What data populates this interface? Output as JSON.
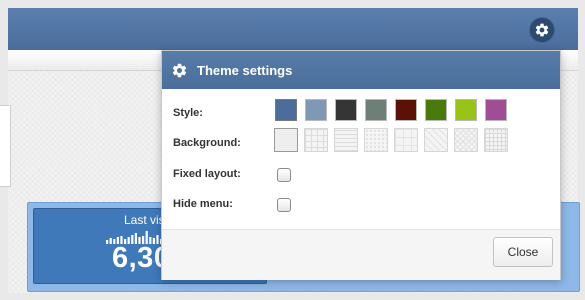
{
  "stat": {
    "title": "Last vis",
    "value": "6,30",
    "sparkline": [
      4,
      6,
      5,
      7,
      9,
      5,
      8,
      10,
      12,
      7,
      9,
      14,
      8,
      6,
      10,
      5
    ]
  },
  "theme_panel": {
    "title": "Theme settings",
    "header_icon": "gear-icon",
    "style_label": "Style:",
    "background_label": "Background:",
    "fixed_layout_label": "Fixed layout:",
    "hide_menu_label": "Hide menu:",
    "fixed_layout_checked": false,
    "hide_menu_checked": false,
    "style_colors": [
      "#4a6d9c",
      "#7f98b6",
      "#353535",
      "#6d7f76",
      "#5a1206",
      "#4a7a0c",
      "#98c318",
      "#a04d96"
    ],
    "selected_style": 0,
    "background_patterns": [
      "plain",
      "grid",
      "lines",
      "dots",
      "tile",
      "tile2",
      "diamond",
      "fine-grid"
    ],
    "selected_background": 0,
    "close_label": "Close"
  },
  "topbar": {
    "settings_icon": "gear-icon"
  }
}
